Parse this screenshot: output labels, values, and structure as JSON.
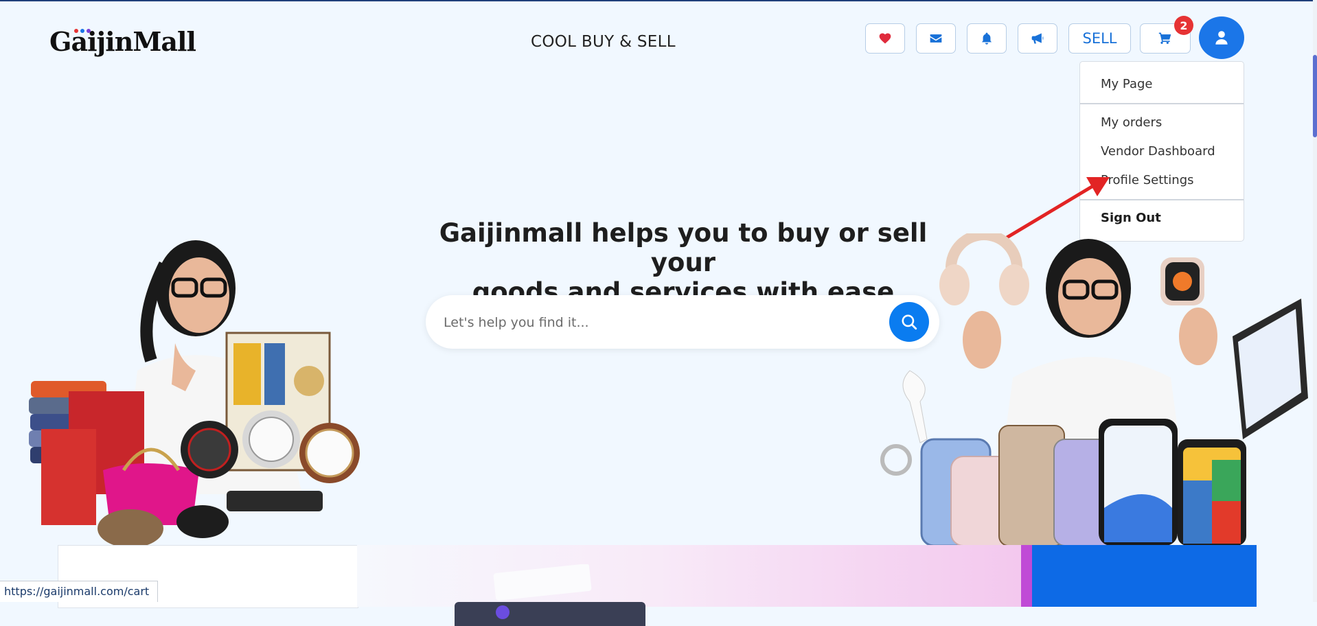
{
  "header": {
    "logo": "GaijinMall",
    "tagline": "COOL BUY & SELL",
    "sell_label": "SELL",
    "cart_count": "2",
    "icons": [
      "heart-icon",
      "envelope-icon",
      "bell-icon",
      "megaphone-icon",
      "cart-icon",
      "user-icon"
    ],
    "brand_color": "#1871d8",
    "badge_color": "#e63334"
  },
  "dropdown": {
    "items": [
      "My Page",
      "My orders",
      "Vendor Dashboard",
      "Profile Settings",
      "Sign Out"
    ]
  },
  "hero": {
    "title_line1": "Gaijinmall helps you to buy or sell your",
    "title_line2": "goods and services with ease",
    "search_placeholder": "Let's help you find it..."
  },
  "statusbar": {
    "url": "https://gaijinmall.com/cart"
  }
}
